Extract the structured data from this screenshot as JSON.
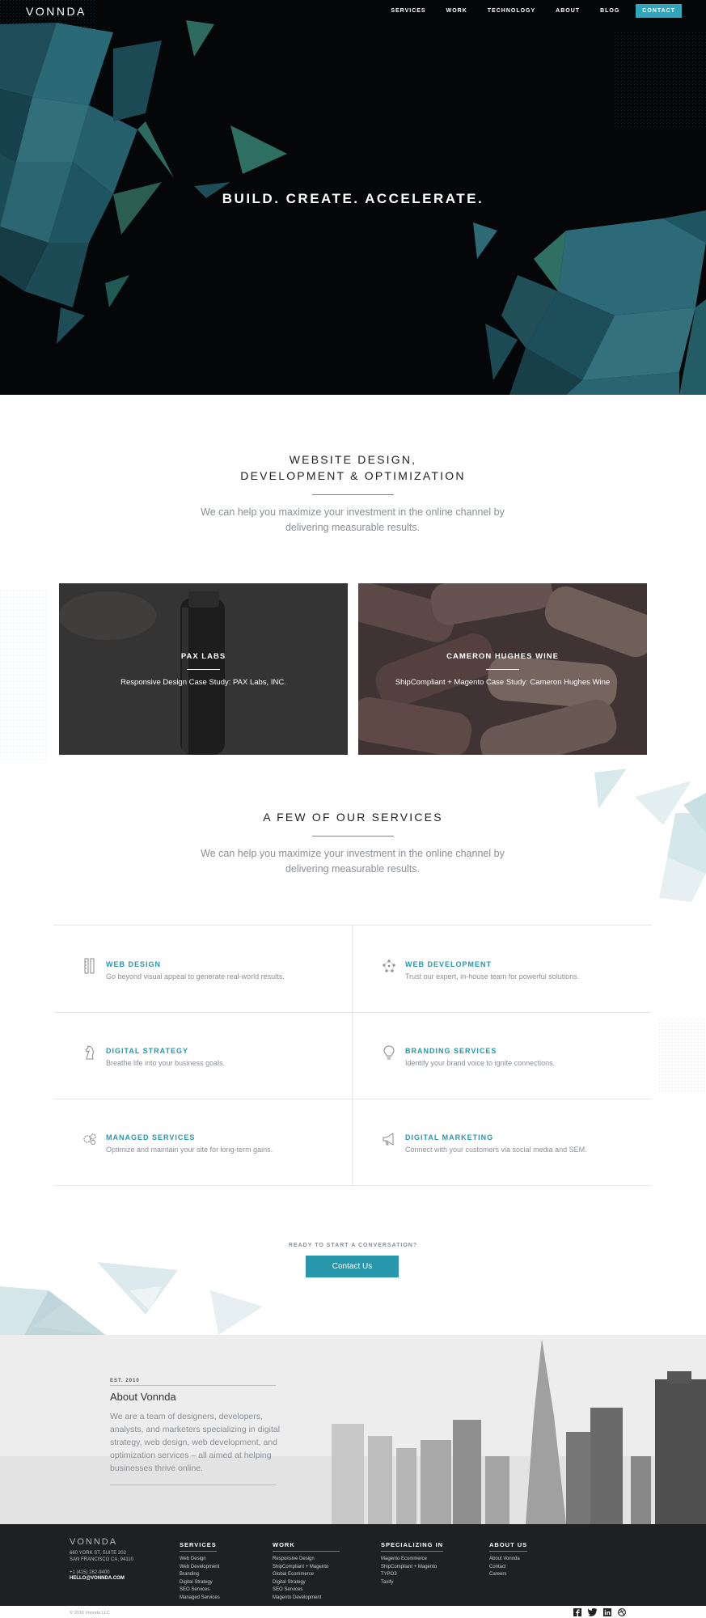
{
  "nav": {
    "logo": "VONNDA",
    "items": [
      "SERVICES",
      "WORK",
      "TECHNOLOGY",
      "ABOUT",
      "BLOG"
    ],
    "cta": "CONTACT"
  },
  "hero": {
    "title": "BUILD. CREATE. ACCELERATE."
  },
  "intro": {
    "title_line1": "WEBSITE DESIGN,",
    "title_line2": "DEVELOPMENT & OPTIMIZATION",
    "subtitle": "We can help you maximize your investment in the online channel by delivering measurable results."
  },
  "cases": [
    {
      "title": "PAX LABS",
      "subtitle": "Responsive Design Case Study: PAX Labs, INC."
    },
    {
      "title": "CAMERON HUGHES WINE",
      "subtitle": "ShipCompliant + Magento Case Study: Cameron Hughes Wine"
    }
  ],
  "services_section": {
    "title": "A FEW OF OUR SERVICES",
    "subtitle": "We can help you maximize your investment in the online channel by delivering measurable results.",
    "items": [
      {
        "title": "WEB DESIGN",
        "desc": "Go beyond visual appeal to generate real-world results.",
        "icon": "pencil-ruler-icon"
      },
      {
        "title": "WEB DEVELOPMENT",
        "desc": "Trust our expert, in-house team for powerful solutions.",
        "icon": "network-icon"
      },
      {
        "title": "DIGITAL STRATEGY",
        "desc": "Breathe life into your business goals.",
        "icon": "chess-knight-icon"
      },
      {
        "title": "BRANDING SERVICES",
        "desc": "Identify your brand voice to ignite connections.",
        "icon": "lightbulb-icon"
      },
      {
        "title": "MANAGED SERVICES",
        "desc": "Optimize and maintain your site for long-term gains.",
        "icon": "gears-icon"
      },
      {
        "title": "DIGITAL MARKETING",
        "desc": "Connect with your customers via social media and SEM.",
        "icon": "megaphone-icon"
      }
    ]
  },
  "cta": {
    "prompt": "READY TO START A CONVERSATION?",
    "button": "Contact Us"
  },
  "about": {
    "est": "EST. 2010",
    "title": "About Vonnda",
    "text": "We are a team of designers, developers, analysts, and marketers specializing in digital strategy, web design, web development, and optimization services – all aimed at helping businesses thrive online."
  },
  "footer": {
    "logo": "VONNDA",
    "address1": "660 YORK ST, SUITE 202",
    "address2": "SAN FRANCISCO CA, 94110",
    "phone": "+1 (415) 282-9400",
    "email": "HELLO@VONNDA.COM",
    "columns": [
      {
        "heading": "SERVICES",
        "links": [
          "Web Design",
          "Web Development",
          "Branding",
          "Digital Strategy",
          "SEO Services",
          "Managed Services"
        ]
      },
      {
        "heading": "WORK",
        "links": [
          "Responsive Design",
          "ShipCompliant + Magento",
          "Global Ecommerce",
          "Digital Strategy",
          "SEO Services",
          "Magento Development"
        ]
      },
      {
        "heading": "SPECIALIZING IN",
        "links": [
          "Magento Ecommerce",
          "ShipCompliant + Magento",
          "TYPO3",
          "Taxify"
        ]
      },
      {
        "heading": "ABOUT US",
        "links": [
          "About Vonnda",
          "Contact",
          "Careers"
        ]
      }
    ],
    "copyright": "© 2016 Vonnda LLC",
    "social": [
      "facebook-icon",
      "twitter-icon",
      "linkedin-icon",
      "dribbble-icon"
    ]
  },
  "colors": {
    "accent": "#2fa6bb",
    "accent_dark": "#2896ab",
    "hero_bg": "#050608",
    "footer_bg": "#1f2021"
  }
}
